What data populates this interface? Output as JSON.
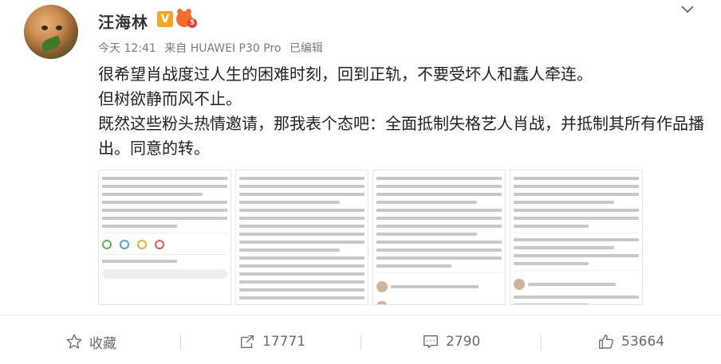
{
  "post": {
    "author": "汪海林",
    "vip_label": "V",
    "level": "5",
    "time": "今天 12:41",
    "source": "来自 HUAWEI P30 Pro",
    "edited": "已编辑",
    "paragraphs": [
      "很希望肖战度过人生的困难时刻，回到正轨，不要受坏人和蠢人牵连。",
      "但树欲静而风不止。",
      "既然这些粉头热情邀请，那我表个态吧：全面抵制失格艺人肖战，并抵制其所有作品播出。同意的转。"
    ]
  },
  "actions": {
    "favorite_label": "收藏",
    "repost_count": "17771",
    "comment_count": "2790",
    "like_count": "53664"
  },
  "icons": {
    "chevron": "chevron-down-icon",
    "favorite": "star-icon",
    "repost": "repost-icon",
    "comment": "comment-icon",
    "like": "thumbs-up-icon"
  },
  "colors": {
    "vip": "#f5a623",
    "level": "#f46b2c",
    "text": "#222222",
    "meta": "#7a7a7a"
  }
}
